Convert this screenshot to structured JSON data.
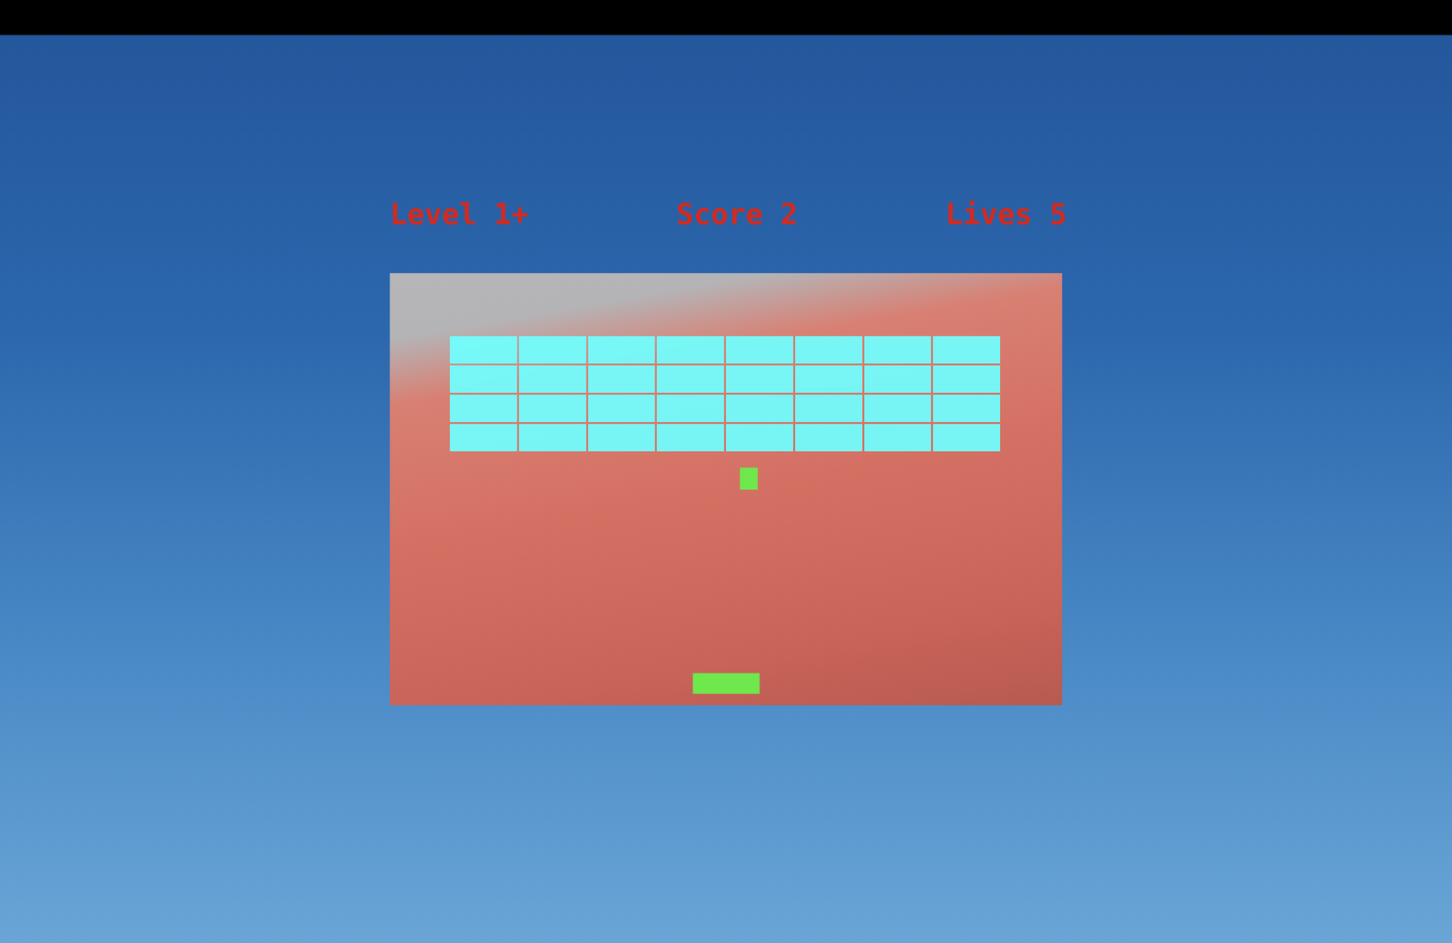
{
  "hud": {
    "level": "Level 1+",
    "score": "Score 2",
    "lives": "Lives 5"
  },
  "bricks": [
    [
      {
        "intact": true
      },
      {
        "intact": true
      },
      {
        "intact": true
      },
      {
        "intact": true
      },
      {
        "intact": true
      },
      {
        "intact": true
      },
      {
        "intact": true
      },
      {
        "intact": true
      }
    ],
    [
      {
        "intact": true
      },
      {
        "intact": true
      },
      {
        "intact": true
      },
      {
        "intact": true
      },
      {
        "intact": true
      },
      {
        "intact": true
      },
      {
        "intact": true
      },
      {
        "intact": true
      }
    ],
    [
      {
        "intact": true
      },
      {
        "intact": true
      },
      {
        "intact": true
      },
      {
        "intact": true
      },
      {
        "intact": true
      },
      {
        "intact": true
      },
      {
        "intact": true
      },
      {
        "intact": true
      }
    ],
    [
      {
        "intact": true
      },
      {
        "intact": true
      },
      {
        "intact": true
      },
      {
        "intact": true
      },
      {
        "intact": true
      },
      {
        "intact": true
      },
      {
        "intact": true
      },
      {
        "intact": true
      }
    ]
  ]
}
